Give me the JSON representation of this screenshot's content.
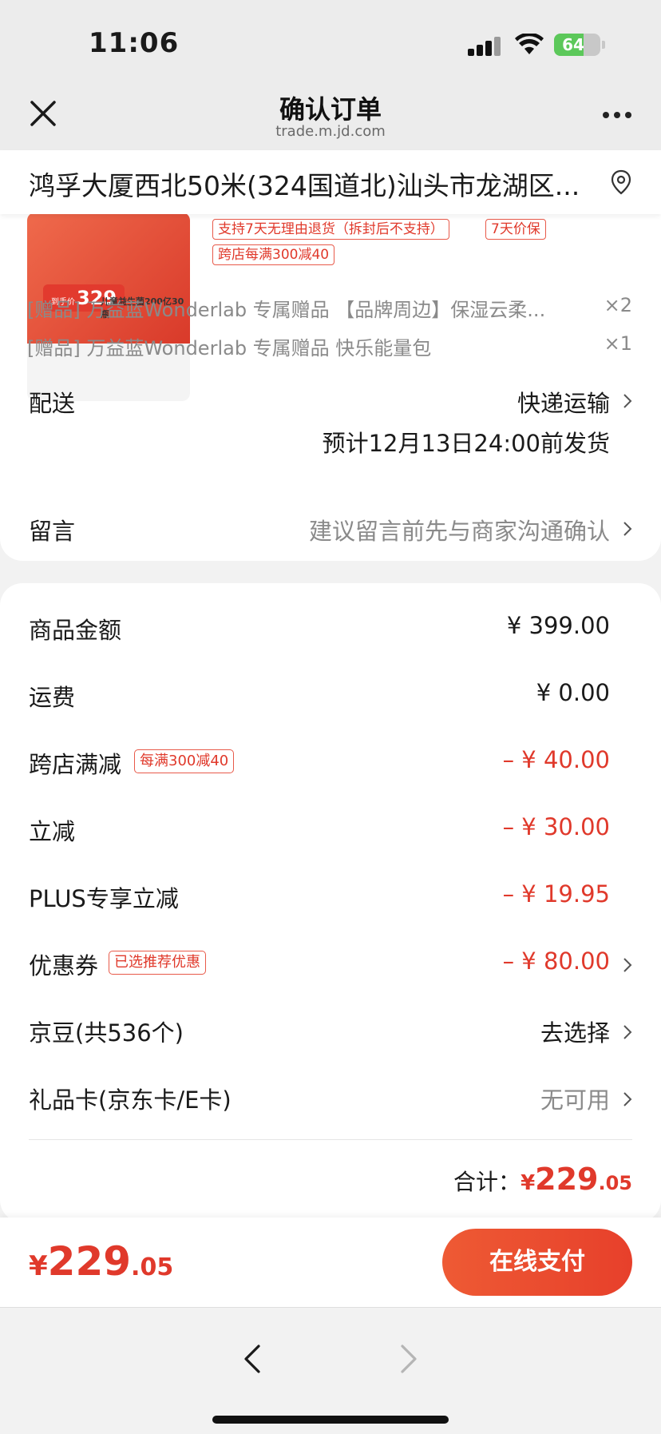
{
  "status_bar": {
    "time": "11:06",
    "battery_level": "64",
    "battery_fraction": 0.64
  },
  "header": {
    "title": "确认订单",
    "url": "trade.m.jd.com",
    "close_icon": "close-icon",
    "more_icon": "more-icon"
  },
  "address": {
    "text": "鸿孚大厦西北50米(324国道北)汕头市龙湖区...",
    "icon": "location-pin-icon"
  },
  "product": {
    "thumb_price_prefix": "到手价",
    "thumb_price": "329",
    "thumb_caption": "儿童益生菌200亿30瓶",
    "tags": [
      "支持7天无理由退货（拆封后不支持）",
      "7天价保",
      "跨店每满300减40"
    ]
  },
  "gifts": [
    {
      "text": "[赠品] 万益蓝Wonderlab 专属赠品 【品牌周边】保湿云柔...",
      "qty": "×2"
    },
    {
      "text": "[赠品] 万益蓝Wonderlab 专属赠品 快乐能量包",
      "qty": "×1"
    }
  ],
  "delivery": {
    "label": "配送",
    "method": "快递运输",
    "estimate": "预计12月13日24:00前发货"
  },
  "message": {
    "label": "留言",
    "placeholder": "建议留言前先与商家沟通确认"
  },
  "price_rows": {
    "goods": {
      "label": "商品金额",
      "value": "¥ 399.00"
    },
    "shipping": {
      "label": "运费",
      "value": "¥ 0.00"
    },
    "cross_store": {
      "label": "跨店满减",
      "tag": "每满300减40",
      "value": "– ¥ 40.00"
    },
    "instant": {
      "label": "立减",
      "value": "– ¥ 30.00"
    },
    "plus": {
      "label": "PLUS专享立减",
      "value": "– ¥ 19.95"
    },
    "coupon": {
      "label": "优惠券",
      "tag": "已选推荐优惠",
      "value": "– ¥ 80.00"
    },
    "jingdou": {
      "label": "京豆(共536个)",
      "value": "去选择"
    },
    "giftcard": {
      "label": "礼品卡(京东卡/E卡)",
      "value": "无可用"
    }
  },
  "total": {
    "label": "合计：",
    "currency": "¥",
    "integer": "229",
    "decimal": ".05"
  },
  "paybar": {
    "currency": "¥",
    "integer": "229",
    "decimal": ".05",
    "button": "在线支付"
  },
  "colors": {
    "accent_red": "#e0392b",
    "pay_gradient_start": "#ee5a34",
    "pay_gradient_end": "#e7402b"
  }
}
